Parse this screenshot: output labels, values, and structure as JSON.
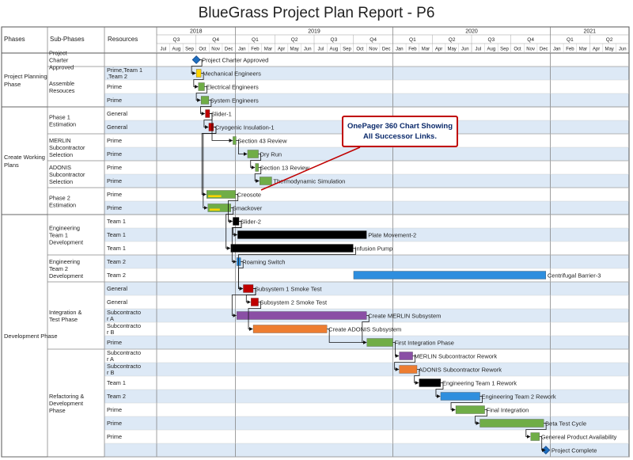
{
  "title": "BlueGrass Project Plan Report - P6",
  "callout": {
    "line1": "OnePager 360 Chart Showing",
    "line2": "All Successor Links."
  },
  "headers": {
    "phases": "Phases",
    "subphases": "Sub-Phases",
    "resources": "Resources"
  },
  "colors": {
    "green": "#70ad47",
    "black": "#000000",
    "blue": "#2e8ede",
    "red": "#c00000",
    "purple": "#8a4fa5",
    "orange": "#ed7d31",
    "diamond": "#1f6fc0",
    "yellow": "#ffd500",
    "row_alt": "#dde9f6",
    "callout_border": "#c00000"
  },
  "chart_data": {
    "type": "gantt",
    "timeline": {
      "start": "2018-07-01",
      "end": "2021-06-30",
      "years": [
        "2018",
        "2019",
        "2020",
        "2021"
      ],
      "quarters": [
        "Q3",
        "Q4",
        "Q1",
        "Q2",
        "Q3",
        "Q4",
        "Q1",
        "Q2",
        "Q3",
        "Q4",
        "Q1",
        "Q2"
      ],
      "months": [
        "Jul",
        "Aug",
        "Sep",
        "Oct",
        "Nov",
        "Dec",
        "Jan",
        "Feb",
        "Mar",
        "Apr",
        "May",
        "Jun",
        "Jul",
        "Aug",
        "Sep",
        "Oct",
        "Nov",
        "Dec",
        "Jan",
        "Feb",
        "Mar",
        "Apr",
        "May",
        "Jun",
        "Jul",
        "Aug",
        "Sep",
        "Oct",
        "Nov",
        "Dec",
        "Jan",
        "Feb",
        "Mar",
        "Apr",
        "May",
        "Jun"
      ]
    },
    "phases": [
      {
        "name": "Project Planning Phase",
        "rows": [
          0,
          3
        ]
      },
      {
        "name": "Create Working Plans",
        "rows": [
          4,
          11
        ]
      },
      {
        "name": "Development Phase",
        "rows": [
          12,
          29
        ]
      }
    ],
    "subphases": [
      {
        "name": "Project Charter Approved",
        "rows": [
          0,
          0
        ]
      },
      {
        "name": "Assemble Resouces",
        "rows": [
          1,
          3
        ]
      },
      {
        "name": "Phase 1 Estimation",
        "rows": [
          4,
          5
        ]
      },
      {
        "name": "MERLIN Subcontractor Selection",
        "rows": [
          6,
          7
        ]
      },
      {
        "name": "ADONIS Subcontractor Selection",
        "rows": [
          8,
          9
        ]
      },
      {
        "name": "Phase 2 Estimation",
        "rows": [
          10,
          11
        ]
      },
      {
        "name": "Engineering Team 1 Development",
        "rows": [
          12,
          14
        ]
      },
      {
        "name": "Engineering Team 2 Development",
        "rows": [
          15,
          16
        ]
      },
      {
        "name": "Integration & Test Phase",
        "rows": [
          17,
          21
        ]
      },
      {
        "name": "Refactoring & Development Phase",
        "rows": [
          22,
          29
        ]
      }
    ],
    "rows": [
      {
        "resource": ""
      },
      {
        "resource": "Prime,Team 1,Team 2"
      },
      {
        "resource": "Prime"
      },
      {
        "resource": "Prime"
      },
      {
        "resource": "General"
      },
      {
        "resource": "General"
      },
      {
        "resource": "Prime"
      },
      {
        "resource": "Prime"
      },
      {
        "resource": "Prime"
      },
      {
        "resource": "Prime"
      },
      {
        "resource": "Prime"
      },
      {
        "resource": "Prime"
      },
      {
        "resource": "Team 1"
      },
      {
        "resource": "Team 1"
      },
      {
        "resource": "Team 1"
      },
      {
        "resource": "Team 2"
      },
      {
        "resource": "Team 2"
      },
      {
        "resource": "General"
      },
      {
        "resource": "General"
      },
      {
        "resource": "Subcontractor A"
      },
      {
        "resource": "Subcontractor B"
      },
      {
        "resource": "Prime"
      },
      {
        "resource": "Subcontractor A"
      },
      {
        "resource": "Subcontractor B"
      },
      {
        "resource": "Team 1"
      },
      {
        "resource": "Team 2"
      },
      {
        "resource": "Prime"
      },
      {
        "resource": "Prime"
      },
      {
        "resource": "Prime"
      },
      {
        "resource": ""
      }
    ],
    "tasks": [
      {
        "id": 0,
        "row": 0,
        "name": "Project Charter Approved",
        "start": "2018-10-01",
        "end": "2018-10-01",
        "color": "diamond",
        "milestone": true
      },
      {
        "id": 1,
        "row": 1,
        "name": "Mechanical Engineers",
        "start": "2018-10-01",
        "end": "2018-10-12",
        "color": "yellow"
      },
      {
        "id": 2,
        "row": 2,
        "name": "Electrical Engineers",
        "start": "2018-10-06",
        "end": "2018-10-20",
        "color": "green"
      },
      {
        "id": 3,
        "row": 3,
        "name": "System Engineers",
        "start": "2018-10-12",
        "end": "2018-10-30",
        "color": "green"
      },
      {
        "id": 4,
        "row": 4,
        "name": "Slider-1",
        "start": "2018-10-22",
        "end": "2018-11-01",
        "color": "red"
      },
      {
        "id": 5,
        "row": 5,
        "name": "Cryogenic Insulation-1",
        "start": "2018-10-30",
        "end": "2018-11-10",
        "color": "red"
      },
      {
        "id": 6,
        "row": 6,
        "name": "Section 43 Review",
        "start": "2018-12-25",
        "end": "2018-12-31",
        "color": "green"
      },
      {
        "id": 7,
        "row": 7,
        "name": "Dry Run",
        "start": "2019-01-28",
        "end": "2019-02-22",
        "color": "green"
      },
      {
        "id": 8,
        "row": 8,
        "name": "Section 13 Review",
        "start": "2019-02-15",
        "end": "2019-02-22",
        "color": "green"
      },
      {
        "id": 9,
        "row": 9,
        "name": "Thermodynamic Simulation",
        "start": "2019-02-25",
        "end": "2019-03-25",
        "color": "green"
      },
      {
        "id": 10,
        "row": 10,
        "name": "Creosote",
        "start": "2018-10-25",
        "end": "2018-12-31",
        "color": "green"
      },
      {
        "id": 11,
        "row": 11,
        "name": "Smackover",
        "start": "2018-10-28",
        "end": "2018-12-20",
        "color": "green"
      },
      {
        "id": 12,
        "row": 12,
        "name": "Slider-2",
        "start": "2018-12-25",
        "end": "2019-01-08",
        "color": "black"
      },
      {
        "id": 13,
        "row": 13,
        "name": "Plate Movement-2",
        "start": "2019-01-05",
        "end": "2019-10-31",
        "color": "black"
      },
      {
        "id": 14,
        "row": 14,
        "name": "Infusion Pump",
        "start": "2018-12-20",
        "end": "2019-09-30",
        "color": "black"
      },
      {
        "id": 15,
        "row": 15,
        "name": "Roaming Switch",
        "start": "2019-01-03",
        "end": "2019-01-12",
        "color": "blue"
      },
      {
        "id": 16,
        "row": 16,
        "name": "Centrifugal Barrier-3",
        "start": "2019-10-01",
        "end": "2020-12-20",
        "color": "blue"
      },
      {
        "id": 17,
        "row": 17,
        "name": "Subsystem 1 Smoke Test",
        "start": "2019-01-18",
        "end": "2019-02-10",
        "color": "red"
      },
      {
        "id": 18,
        "row": 18,
        "name": "Subsystem 2 Smoke Test",
        "start": "2019-02-05",
        "end": "2019-02-22",
        "color": "red"
      },
      {
        "id": 19,
        "row": 19,
        "name": "Create MERLIN Subsystem",
        "start": "2019-01-03",
        "end": "2019-10-31",
        "color": "purple"
      },
      {
        "id": 20,
        "row": 20,
        "name": "Create ADONIS Subsystem",
        "start": "2019-02-10",
        "end": "2019-07-31",
        "color": "orange"
      },
      {
        "id": 21,
        "row": 21,
        "name": "First Integration Phase",
        "start": "2019-11-01",
        "end": "2019-12-31",
        "color": "green"
      },
      {
        "id": 22,
        "row": 22,
        "name": "MERLIN Subcontractor Rework",
        "start": "2020-01-15",
        "end": "2020-02-15",
        "color": "purple"
      },
      {
        "id": 23,
        "row": 23,
        "name": "ADONIS Subcontractor Rework",
        "start": "2020-01-15",
        "end": "2020-02-25",
        "color": "orange"
      },
      {
        "id": 24,
        "row": 24,
        "name": "Engineering Team 1 Rework",
        "start": "2020-03-01",
        "end": "2020-04-20",
        "color": "black"
      },
      {
        "id": 25,
        "row": 25,
        "name": "Engineering Team 2 Rework",
        "start": "2020-04-20",
        "end": "2020-07-20",
        "color": "blue"
      },
      {
        "id": 26,
        "row": 26,
        "name": "Final Integration",
        "start": "2020-05-25",
        "end": "2020-07-31",
        "color": "green"
      },
      {
        "id": 27,
        "row": 27,
        "name": "Beta Test Cycle",
        "start": "2020-07-20",
        "end": "2020-12-15",
        "color": "green"
      },
      {
        "id": 28,
        "row": 28,
        "name": "Genereal Product Availability",
        "start": "2020-11-15",
        "end": "2020-12-05",
        "color": "green"
      },
      {
        "id": 29,
        "row": 29,
        "name": "Project Complete",
        "start": "2020-12-20",
        "end": "2020-12-20",
        "color": "diamond",
        "milestone": true
      }
    ],
    "links": [
      [
        0,
        1
      ],
      [
        1,
        2
      ],
      [
        2,
        3
      ],
      [
        3,
        4
      ],
      [
        4,
        5
      ],
      [
        5,
        10
      ],
      [
        5,
        11
      ],
      [
        4,
        6
      ],
      [
        6,
        7
      ],
      [
        7,
        8
      ],
      [
        8,
        9
      ],
      [
        10,
        12
      ],
      [
        11,
        14
      ],
      [
        12,
        13
      ],
      [
        12,
        15
      ],
      [
        14,
        17
      ],
      [
        15,
        17
      ],
      [
        17,
        18
      ],
      [
        17,
        19
      ],
      [
        18,
        20
      ],
      [
        19,
        21
      ],
      [
        20,
        21
      ],
      [
        21,
        22
      ],
      [
        22,
        23
      ],
      [
        23,
        24
      ],
      [
        24,
        25
      ],
      [
        25,
        26
      ],
      [
        26,
        27
      ],
      [
        27,
        28
      ],
      [
        28,
        29
      ]
    ]
  }
}
